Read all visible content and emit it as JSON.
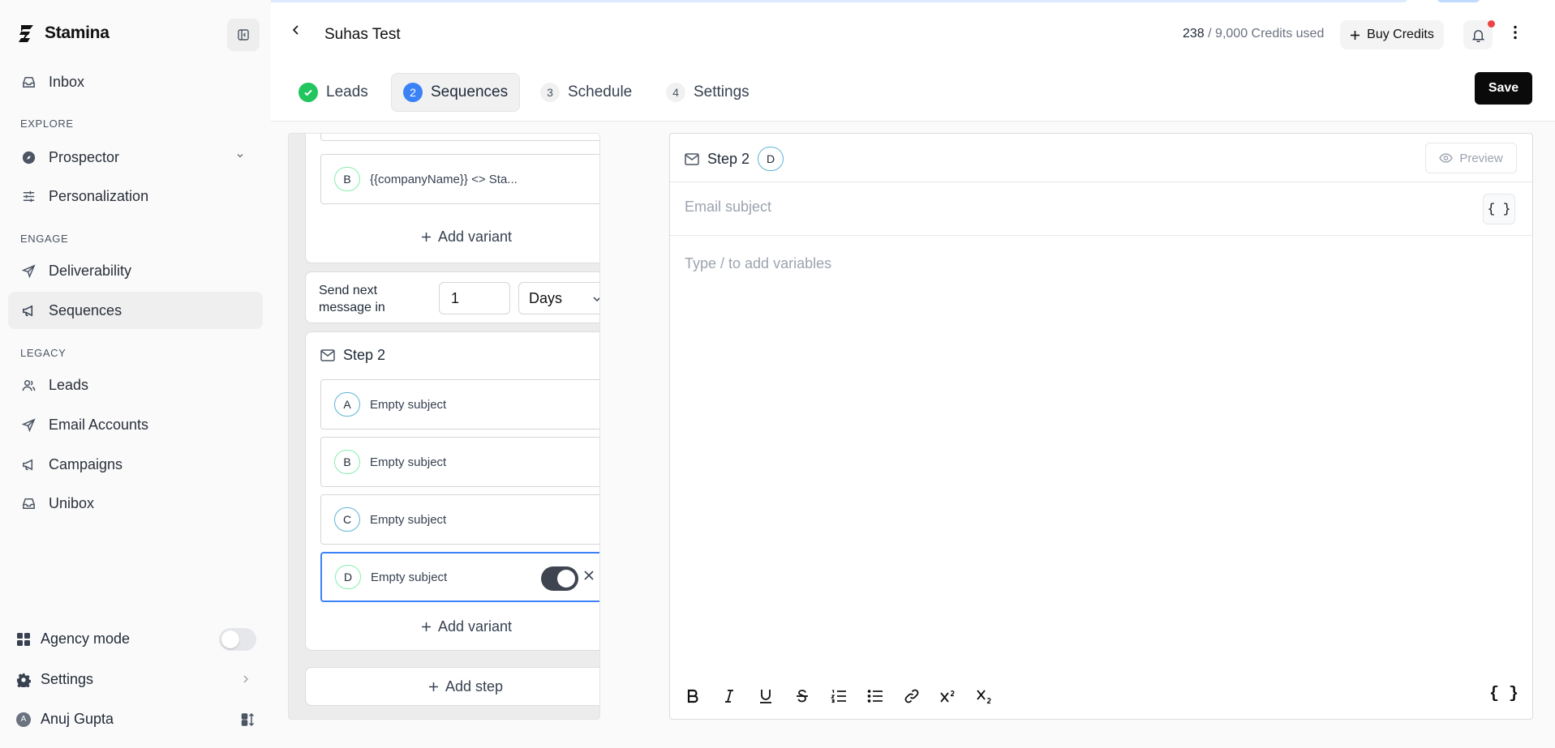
{
  "app": {
    "name": "Stamina"
  },
  "sidebar": {
    "inbox": "Inbox",
    "explore_label": "EXPLORE",
    "prospector": "Prospector",
    "personalization": "Personalization",
    "engage_label": "ENGAGE",
    "deliverability": "Deliverability",
    "sequences": "Sequences",
    "legacy_label": "LEGACY",
    "leads": "Leads",
    "email_accounts": "Email Accounts",
    "campaigns": "Campaigns",
    "unibox": "Unibox",
    "agency_mode": "Agency mode",
    "agency_mode_enabled": false,
    "settings": "Settings",
    "user_name": "Anuj Gupta",
    "user_initial": "A"
  },
  "header": {
    "title": "Suhas Test",
    "credits_used": "238",
    "credits_total": "/ 9,000 Credits used",
    "buy_credits": "Buy Credits"
  },
  "tabs": [
    {
      "num": "",
      "label": "Leads",
      "state": "done"
    },
    {
      "num": "2",
      "label": "Sequences",
      "state": "active"
    },
    {
      "num": "3",
      "label": "Schedule",
      "state": "todo"
    },
    {
      "num": "4",
      "label": "Settings",
      "state": "todo"
    }
  ],
  "save_label": "Save",
  "sequence": {
    "step1_variants": [
      {
        "letter": "B",
        "subject": "{{companyName}} <> Sta..."
      }
    ],
    "add_variant": "Add variant",
    "wait": {
      "label": "Send next message in",
      "value": "1",
      "unit": "Days"
    },
    "step2": {
      "title": "Step 2",
      "variants": [
        {
          "letter": "A",
          "subject": "Empty subject"
        },
        {
          "letter": "B",
          "subject": "Empty subject"
        },
        {
          "letter": "C",
          "subject": "Empty subject"
        },
        {
          "letter": "D",
          "subject": "Empty subject",
          "selected": true,
          "enabled": true
        }
      ]
    },
    "add_step": "Add step"
  },
  "editor": {
    "title": "Step 2",
    "variant": "D",
    "preview": "Preview",
    "subject_placeholder": "Email subject",
    "body_placeholder": "Type / to add variables",
    "var_symbol": "{ }",
    "toolbar_icons": [
      "bold-icon",
      "italic-icon",
      "underline-icon",
      "strikethrough-icon",
      "ordered-list-icon",
      "bullet-list-icon",
      "link-icon",
      "superscript-icon",
      "subscript-icon"
    ]
  },
  "colors": {
    "accent": "#3b82f6",
    "success": "#22c55e",
    "notification": "#ef4444",
    "primary_button": "#0a0a0a"
  }
}
